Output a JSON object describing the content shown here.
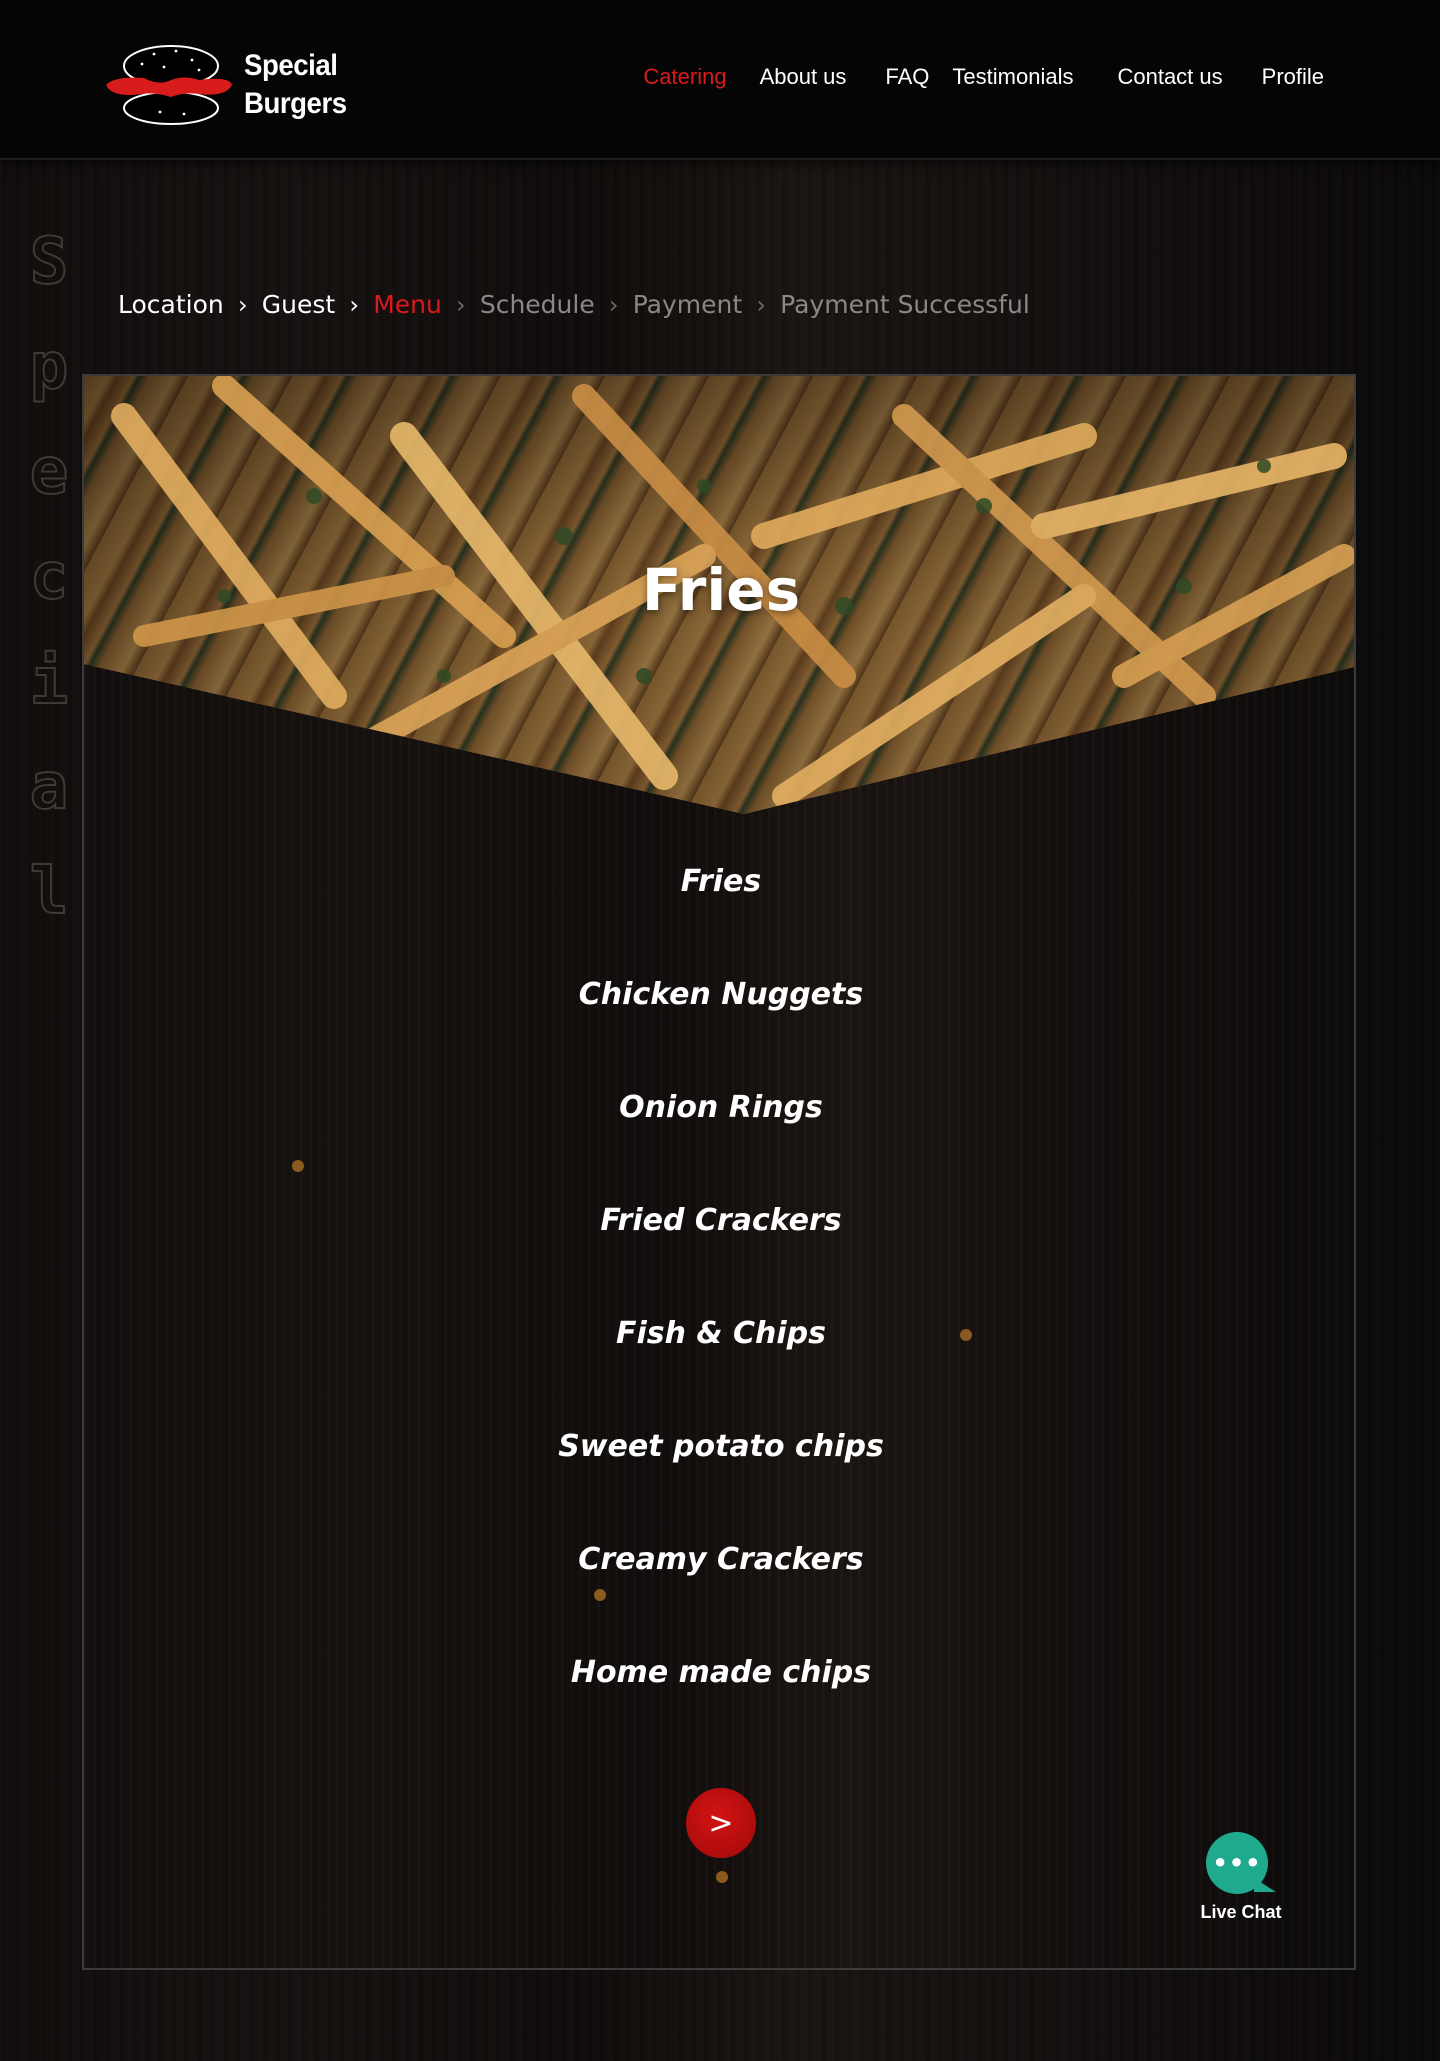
{
  "brand": {
    "line1": "Special",
    "line2": "Burgers",
    "accent_color": "#d81b1b"
  },
  "nav": {
    "items": [
      {
        "label": "Catering",
        "active": true
      },
      {
        "label": "About us",
        "active": false
      },
      {
        "label": "FAQ",
        "active": false
      },
      {
        "label": "Testimonials",
        "active": false
      },
      {
        "label": "Contact us",
        "active": false
      },
      {
        "label": "Profile",
        "active": false
      }
    ]
  },
  "side_word": [
    "S",
    "p",
    "e",
    "c",
    "i",
    "a",
    "l"
  ],
  "breadcrumb": {
    "steps": [
      {
        "label": "Location",
        "state": "done"
      },
      {
        "label": "Guest",
        "state": "done"
      },
      {
        "label": "Menu",
        "state": "current"
      },
      {
        "label": "Schedule",
        "state": "future"
      },
      {
        "label": "Payment",
        "state": "future"
      },
      {
        "label": "Payment Successful",
        "state": "future"
      }
    ],
    "separator": "›"
  },
  "category": {
    "title": "Fries",
    "items": [
      "Fries",
      "Chicken Nuggets",
      "Onion Rings",
      "Fried Crackers",
      "Fish & Chips",
      "Sweet potato chips",
      "Creamy Crackers",
      "Home made chips"
    ]
  },
  "next_button": {
    "icon": "chevron-right-icon",
    "glyph": ">"
  },
  "live_chat": {
    "label": "Live Chat",
    "icon": "chat-bubble-icon",
    "glyph": "•••",
    "color": "#1fa98d"
  }
}
